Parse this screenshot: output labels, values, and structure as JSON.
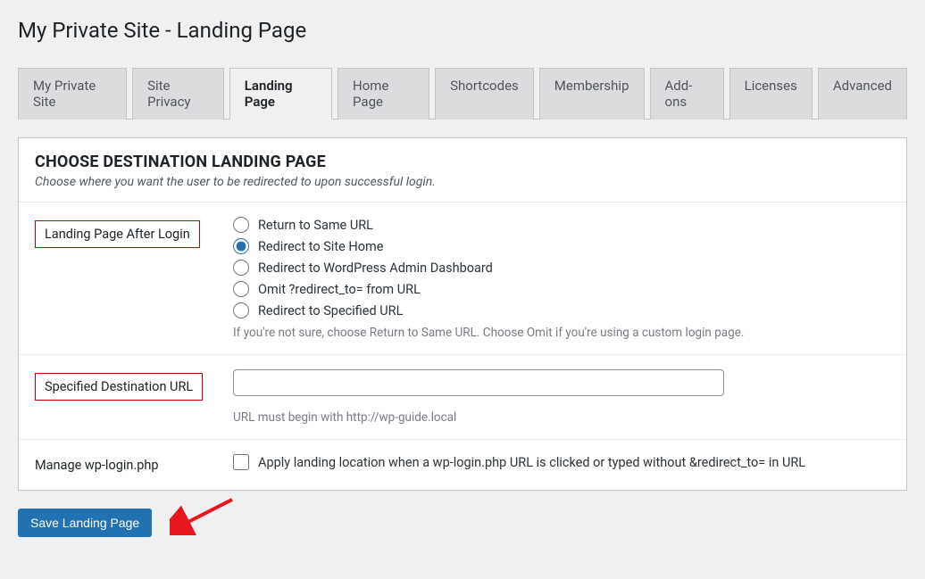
{
  "page": {
    "title": "My Private Site - Landing Page"
  },
  "tabs": [
    {
      "label": "My Private Site"
    },
    {
      "label": "Site Privacy"
    },
    {
      "label": "Landing Page"
    },
    {
      "label": "Home Page"
    },
    {
      "label": "Shortcodes"
    },
    {
      "label": "Membership"
    },
    {
      "label": "Add-ons"
    },
    {
      "label": "Licenses"
    },
    {
      "label": "Advanced"
    }
  ],
  "section": {
    "heading": "CHOOSE DESTINATION LANDING PAGE",
    "description": "Choose where you want the user to be redirected to upon successful login."
  },
  "landing_after_login": {
    "label": "Landing Page After Login",
    "options": [
      {
        "label": "Return to Same URL"
      },
      {
        "label": "Redirect to Site Home"
      },
      {
        "label": "Redirect to WordPress Admin Dashboard"
      },
      {
        "label": "Omit ?redirect_to= from URL"
      },
      {
        "label": "Redirect to Specified URL"
      }
    ],
    "help": "If you're not sure, choose Return to Same URL. Choose Omit if you're using a custom login page."
  },
  "specified_url": {
    "label": "Specified Destination URL",
    "value": "",
    "help": "URL must begin with http://wp-guide.local"
  },
  "manage_wp_login": {
    "label": "Manage wp-login.php",
    "checkbox_label": "Apply landing location when a wp-login.php URL is clicked or typed without &redirect_to= in URL"
  },
  "actions": {
    "save": "Save Landing Page"
  }
}
